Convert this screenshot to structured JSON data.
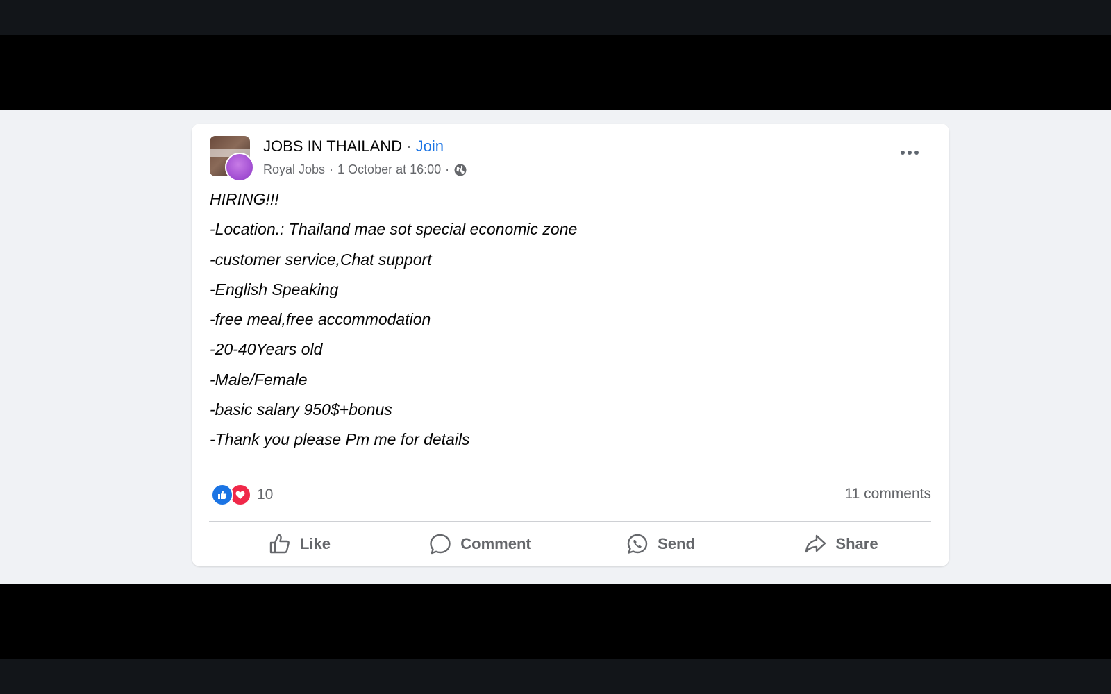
{
  "post": {
    "group_name": "JOBS IN THAILAND",
    "separator": "·",
    "join_label": "Join",
    "author": "Royal Jobs",
    "timestamp": "1 October at 16:00",
    "privacy_icon": "globe-icon",
    "lines": [
      "HIRING!!!",
      "-Location.: Thailand mae sot special economic zone",
      "-customer service,Chat support",
      "-English Speaking",
      "-free meal,free accommodation",
      "-20-40Years old",
      "-Male/Female",
      "-basic salary 950$+bonus",
      "-Thank you please Pm me for details"
    ]
  },
  "engagement": {
    "reaction_icons": [
      "like-reaction-icon",
      "love-reaction-icon"
    ],
    "reaction_count": "10",
    "comments_label": "11 comments"
  },
  "actions": {
    "like": "Like",
    "comment": "Comment",
    "send": "Send",
    "share": "Share"
  },
  "colors": {
    "link_blue": "#1b74e4",
    "like_blue": "#1b74e4",
    "love_red": "#f02849",
    "muted_text": "#65676b",
    "feed_background": "#f0f2f5"
  }
}
